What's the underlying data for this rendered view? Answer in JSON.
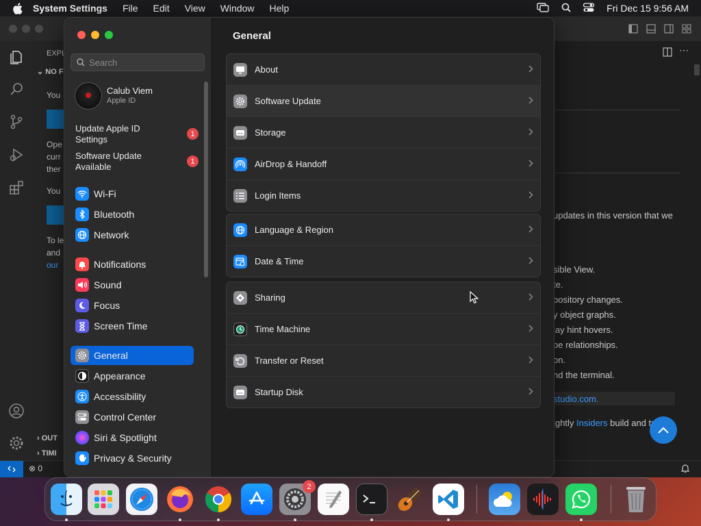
{
  "menubar": {
    "app_name": "System Settings",
    "menus": [
      "File",
      "Edit",
      "View",
      "Window",
      "Help"
    ],
    "datetime": "Fri Dec 15  9:56 AM"
  },
  "vscode": {
    "sidebar": {
      "explorer_label": "EXPL",
      "section_label": "NO F",
      "lines": [
        "You",
        "Ope",
        "curr",
        "ther",
        "You",
        "To le",
        "and",
        "our"
      ],
      "outline_label": "OUT",
      "timeline_label": "TIMI"
    },
    "editor_lines": [
      "updates in this version that we",
      "sible View.",
      "te.",
      "pository changes.",
      "y object graphs.",
      "lay hint hovers.",
      "pe relationships.",
      "on.",
      "nd the terminal.",
      "studio.com.",
      "ightly",
      "Insiders",
      "build and try"
    ],
    "status": {
      "errors": "0"
    }
  },
  "settings": {
    "search_placeholder": "Search",
    "account": {
      "name": "Calub Viem",
      "subtitle": "Apple ID"
    },
    "notices": [
      {
        "label": "Update Apple ID Settings",
        "badge": "1"
      },
      {
        "label": "Software Update Available",
        "badge": "1"
      }
    ],
    "sidebar_items": [
      {
        "label": "Wi-Fi",
        "color": "#1a8cff"
      },
      {
        "label": "Bluetooth",
        "color": "#1a8cff"
      },
      {
        "label": "Network",
        "color": "#1a8cff"
      },
      {
        "label": "Notifications",
        "color": "#ff4a4a"
      },
      {
        "label": "Sound",
        "color": "#ff3b5c"
      },
      {
        "label": "Focus",
        "color": "#5e5ce6"
      },
      {
        "label": "Screen Time",
        "color": "#5e5ce6"
      },
      {
        "label": "General",
        "color": "#8e8e93"
      },
      {
        "label": "Appearance",
        "color": "#1c1c1e"
      },
      {
        "label": "Accessibility",
        "color": "#1a8cff"
      },
      {
        "label": "Control Center",
        "color": "#8e8e93"
      },
      {
        "label": "Siri & Spotlight",
        "color": "#b04aff"
      },
      {
        "label": "Privacy & Security",
        "color": "#1a8cff"
      }
    ],
    "main_title": "General",
    "groups": [
      [
        "About",
        "Software Update",
        "Storage",
        "AirDrop & Handoff",
        "Login Items"
      ],
      [
        "Language & Region",
        "Date & Time"
      ],
      [
        "Sharing",
        "Time Machine",
        "Transfer or Reset",
        "Startup Disk"
      ]
    ],
    "accent_color": "#0a64d9"
  },
  "dock": {
    "apps": [
      "Finder",
      "Launchpad",
      "Safari",
      "Firefox",
      "Chrome",
      "App Store",
      "System Settings",
      "TextEdit",
      "Terminal",
      "GarageBand",
      "Visual Studio Code",
      "Weather",
      "Voice Memos",
      "WhatsApp",
      "Trash"
    ],
    "settings_badge": "2"
  }
}
